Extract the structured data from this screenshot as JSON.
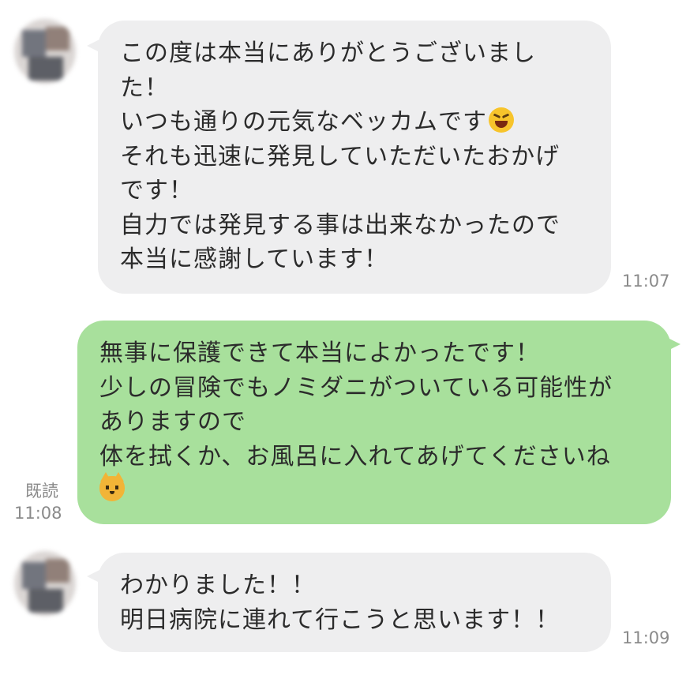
{
  "conversation": {
    "messages": [
      {
        "direction": "incoming",
        "lines": [
          "この度は本当にありがとうございまし",
          "た！",
          "いつも通りの元気なベッカムです",
          "それも迅速に発見していただいたおかげ",
          "です！",
          "自力では発見する事は出来なかったので",
          "本当に感謝しています！"
        ],
        "time": "11:07",
        "emoji": "grinning-squinting-face-icon"
      },
      {
        "direction": "outgoing",
        "lines": [
          "無事に保護できて本当によかったです！",
          "少しの冒険でもノミダニがついている可能性が",
          "ありますので",
          "体を拭くか、お風呂に入れてあげてくださいね"
        ],
        "read_label": "既読",
        "time": "11:08",
        "emoji": "cat-face-icon"
      },
      {
        "direction": "incoming",
        "lines": [
          "わかりました！！",
          "明日病院に連れて行こうと思います！！"
        ],
        "time": "11:09"
      }
    ]
  },
  "colors": {
    "incoming_bubble": "#eeeeef",
    "outgoing_bubble": "#a8e09c",
    "meta_text": "#8a8a8a"
  }
}
